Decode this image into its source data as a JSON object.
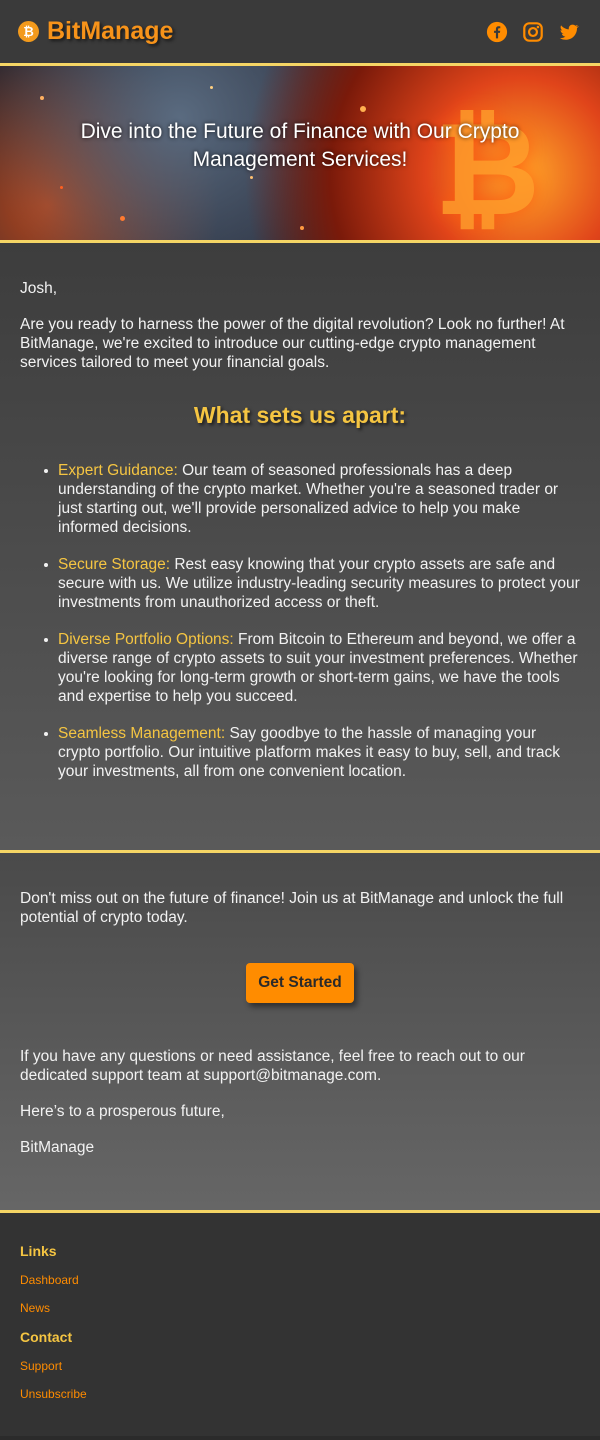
{
  "header": {
    "brand": "BitManage",
    "coin_symbol": "₿",
    "brand_color": "#f7931a",
    "socials": [
      "facebook-icon",
      "instagram-icon",
      "twitter-icon"
    ]
  },
  "hero": {
    "title": "Dive into the Future of Finance with Our Crypto Management Services!"
  },
  "main": {
    "greeting": "Josh,",
    "intro": "Are you ready to harness the power of the digital revolution? Look no further! At BitManage, we're excited to introduce our cutting-edge crypto management services tailored to meet your financial goals.",
    "section_title": "What sets us apart:",
    "features": [
      {
        "title": "Expert Guidance:",
        "text": " Our team of seasoned professionals has a deep understanding of the crypto market. Whether you're a seasoned trader or just starting out, we'll provide personalized advice to help you make informed decisions."
      },
      {
        "title": "Secure Storage:",
        "text": " Rest easy knowing that your crypto assets are safe and secure with us. We utilize industry-leading security measures to protect your investments from unauthorized access or theft."
      },
      {
        "title": "Diverse Portfolio Options:",
        "text": " From Bitcoin to Ethereum and beyond, we offer a diverse range of crypto assets to suit your investment preferences. Whether you're looking for long-term growth or short-term gains, we have the tools and expertise to help you succeed."
      },
      {
        "title": "Seamless Management:",
        "text": " Say goodbye to the hassle of managing your crypto portfolio. Our intuitive platform makes it easy to buy, sell, and track your investments, all from one convenient location."
      }
    ]
  },
  "cta": {
    "text": "Don't miss out on the future of finance! Join us at BitManage and unlock the full potential of crypto today.",
    "button": "Get Started",
    "support": "If you have any questions or need assistance, feel free to reach out to our dedicated support team at support@bitmanage.com.",
    "closing": "Here’s to a prosperous future,",
    "signature": "BitManage"
  },
  "footer": {
    "links_heading": "Links",
    "links": [
      "Dashboard",
      "News"
    ],
    "contact_heading": "Contact",
    "contact_links": [
      "Support",
      "Unsubscribe"
    ]
  },
  "colors": {
    "accent": "#f5c542",
    "border": "#f5d565",
    "button": "#ff8c00"
  }
}
